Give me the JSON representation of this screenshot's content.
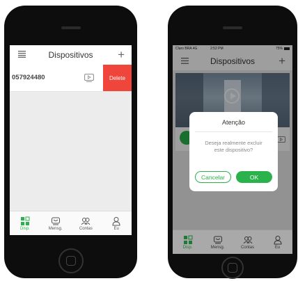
{
  "left_phone": {
    "nav": {
      "title": "Dispositivos",
      "left_icon": "menu-icon",
      "right_icon": "plus-icon",
      "right_glyph": "+"
    },
    "device_row": {
      "id": "057924480",
      "delete_label": "Delete"
    },
    "tabs": [
      {
        "label": "Disp.",
        "icon": "devices-icon",
        "active": true
      },
      {
        "label": "Mensg.",
        "icon": "message-icon",
        "active": false
      },
      {
        "label": "Contas",
        "icon": "contacts-icon",
        "active": false
      },
      {
        "label": "Eu",
        "icon": "profile-icon",
        "active": false
      }
    ]
  },
  "right_phone": {
    "status_bar": {
      "carrier": "Claro BRA 4G",
      "time": "2:52 PM",
      "battery": "75%"
    },
    "nav": {
      "title": "Dispositivos",
      "left_icon": "menu-icon",
      "right_icon": "plus-icon",
      "right_glyph": "+"
    },
    "dialog": {
      "title": "Atenção",
      "message_line1": "Deseja realmente excluir",
      "message_line2": "este dispositivo?",
      "cancel_label": "Cancelar",
      "ok_label": "OK"
    },
    "tabs": [
      {
        "label": "Disp.",
        "icon": "devices-icon",
        "active": true
      },
      {
        "label": "Mensg.",
        "icon": "message-icon",
        "active": false
      },
      {
        "label": "Contas",
        "icon": "contacts-icon",
        "active": false
      },
      {
        "label": "Eu",
        "icon": "profile-icon",
        "active": false
      }
    ]
  },
  "colors": {
    "accent": "#2bb24c",
    "delete": "#f0453a"
  }
}
